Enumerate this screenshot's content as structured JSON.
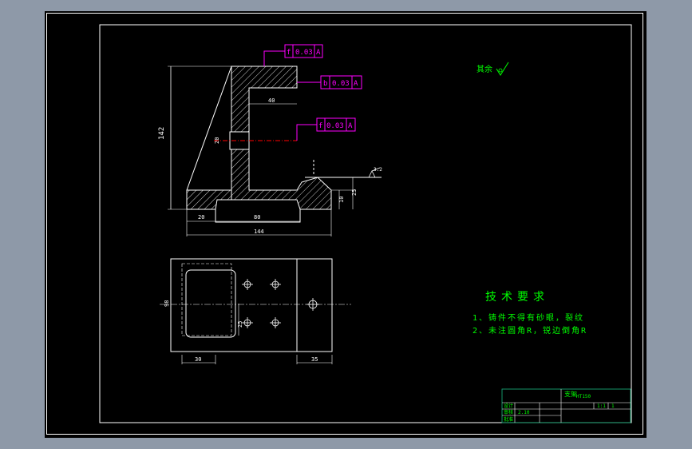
{
  "drawing": {
    "roughness_note": "其余",
    "tolerances": [
      {
        "symbol": "f",
        "value": "0.03",
        "datum": "A"
      },
      {
        "symbol": "b",
        "value": "0.03",
        "datum": "A"
      },
      {
        "symbol": "f",
        "value": "0.03",
        "datum": "A"
      }
    ],
    "roughness_value": "3.2",
    "dimensions": {
      "height_total": "142",
      "slot_depth": "40",
      "hole": "20",
      "right_height": "25",
      "right_small": "10",
      "bottom_left": "20",
      "bottom_mid": "80",
      "overall_length": "144",
      "plan_left": "30",
      "plan_right": "35",
      "plan_width": "98",
      "plan_inner": "25"
    },
    "tech_req": {
      "title": "技术要求",
      "line1": "1、铸件不得有砂眼，裂纹",
      "line2": "2、未注圆角R，锐边倒角R"
    },
    "title_block": {
      "part_name": "支架",
      "material": "HT150",
      "scale": "1:1",
      "count": "1",
      "role_design": "设计",
      "role_check": "审核",
      "role_approve": "批准",
      "date": "2.10"
    }
  },
  "colors": {
    "geometry": "#ffffff",
    "tolerance": "#ff00ff",
    "text": "#00ff00",
    "center": "#ff0000",
    "hatch": "#ffffff"
  }
}
